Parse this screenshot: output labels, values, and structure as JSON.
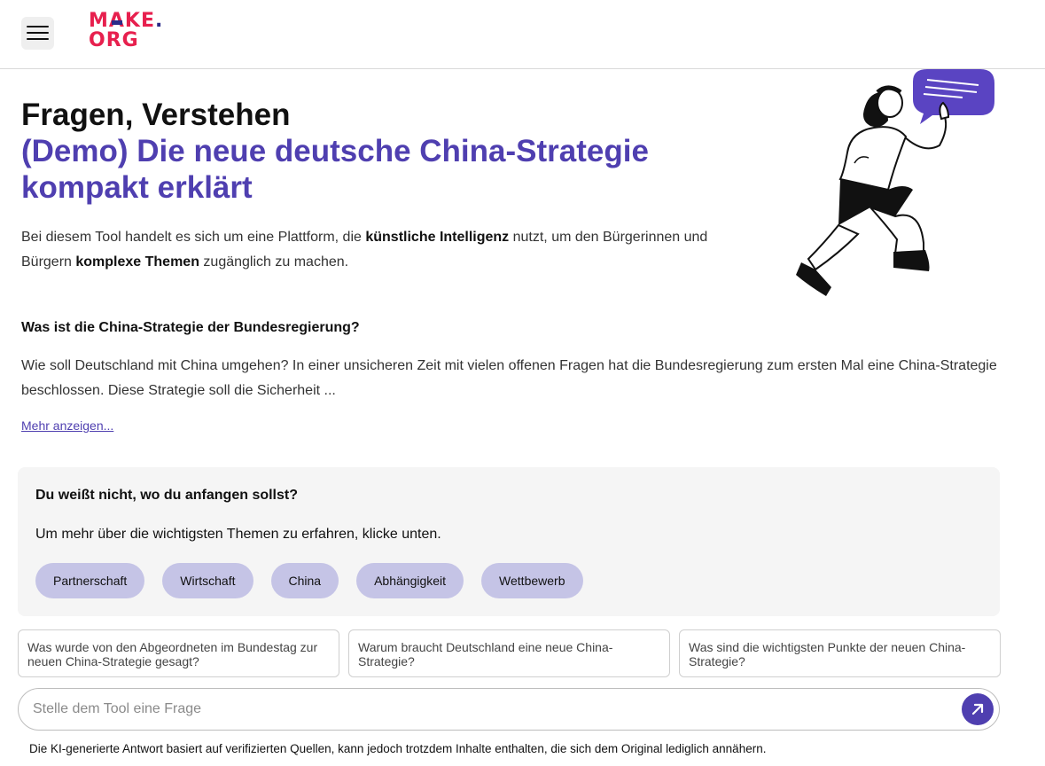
{
  "header": {
    "logo_line1": "MAKE",
    "logo_line1_dot": ".",
    "logo_line2": "ORG"
  },
  "hero": {
    "title_line1": "Fragen, Verstehen",
    "title_line2": "(Demo) Die neue deutsche China-Strategie kompakt erklärt",
    "intro": {
      "part1": "Bei diesem Tool handelt es sich um eine Plattform, die ",
      "bold1": "künstliche Intelligenz",
      "part2": " nutzt, um den Bürgerinnen und Bürgern ",
      "bold2": "komplexe Themen",
      "part3": " zugänglich zu machen."
    }
  },
  "question": {
    "title": "Was ist die China-Strategie der Bundesregierung?",
    "text": "Wie soll Deutschland mit China umgehen? In einer unsicheren Zeit mit vielen offenen Fragen hat die Bundesregierung zum ersten Mal eine China-Strategie beschlossen. Diese Strategie soll die Sicherheit ...",
    "more_link": "Mehr anzeigen..."
  },
  "start_box": {
    "heading": "Du weißt nicht, wo du anfangen sollst?",
    "text": "Um mehr über die wichtigsten Themen zu erfahren, klicke unten.",
    "chips": [
      "Partnerschaft",
      "Wirtschaft",
      "China",
      "Abhängigkeit",
      "Wettbewerb"
    ]
  },
  "suggestions": [
    "Was wurde von den Abgeordneten im Bundestag zur neuen China-Strategie gesagt?",
    "Warum braucht Deutschland eine neue China-Strategie?",
    "Was sind die wichtigsten Punkte der neuen China-Strategie?"
  ],
  "ask": {
    "placeholder": "Stelle dem Tool eine Frage",
    "value": ""
  },
  "disclaimer": "Die KI-generierte Antwort basiert auf verifizierten Quellen, kann jedoch trotzdem Inhalte enthalten, die sich dem Original lediglich annähern.",
  "icons": {
    "menu": "hamburger-menu-icon",
    "send": "arrow-up-right-icon",
    "illustration": "person-with-speech-bubble-illustration"
  },
  "colors": {
    "accent": "#4f3fb0",
    "chip_bg": "#c5c4e6",
    "logo_red": "#e7204e",
    "logo_navy": "#2b2b88",
    "panel_bg": "#f5f5f5"
  }
}
